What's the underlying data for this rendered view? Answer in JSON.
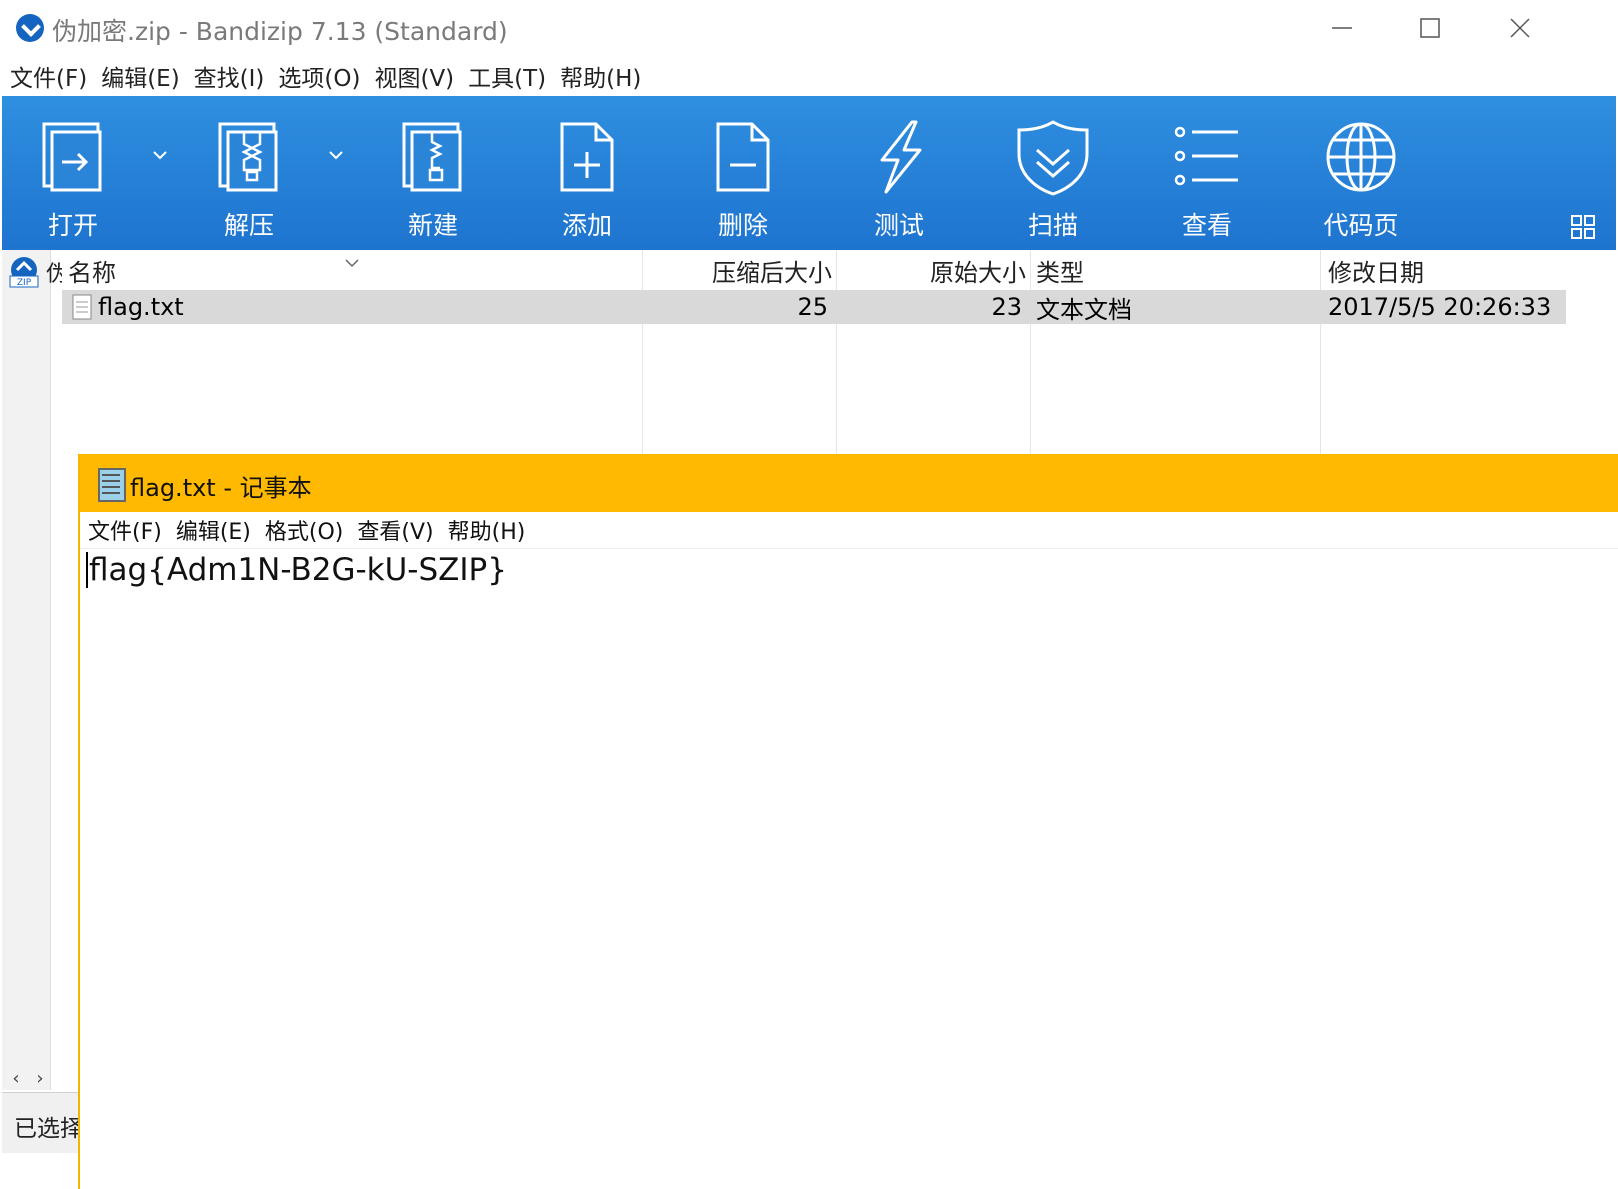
{
  "app": {
    "title": "伪加密.zip - Bandizip 7.13 (Standard)"
  },
  "menu": [
    "文件(F)",
    "编辑(E)",
    "查找(I)",
    "选项(O)",
    "视图(V)",
    "工具(T)",
    "帮助(H)"
  ],
  "toolbar": {
    "open": "打开",
    "extract": "解压",
    "new": "新建",
    "add": "添加",
    "delete": "删除",
    "test": "测试",
    "scan": "扫描",
    "view": "查看",
    "codepage": "代码页"
  },
  "sidebar": {
    "folder_initial": "伪"
  },
  "file_list": {
    "columns": {
      "name": "名称",
      "compressed": "压缩后大小",
      "original": "原始大小",
      "type": "类型",
      "modified": "修改日期"
    },
    "rows": [
      {
        "name": "flag.txt",
        "compressed": "25",
        "original": "23",
        "type": "文本文档",
        "modified": "2017/5/5 20:26:33"
      }
    ]
  },
  "status": {
    "text": "已选择"
  },
  "notepad": {
    "title": "flag.txt - 记事本",
    "menu": [
      "文件(F)",
      "编辑(E)",
      "格式(O)",
      "查看(V)",
      "帮助(H)"
    ],
    "content": "flag{Adm1N-B2G-kU-SZIP}"
  }
}
